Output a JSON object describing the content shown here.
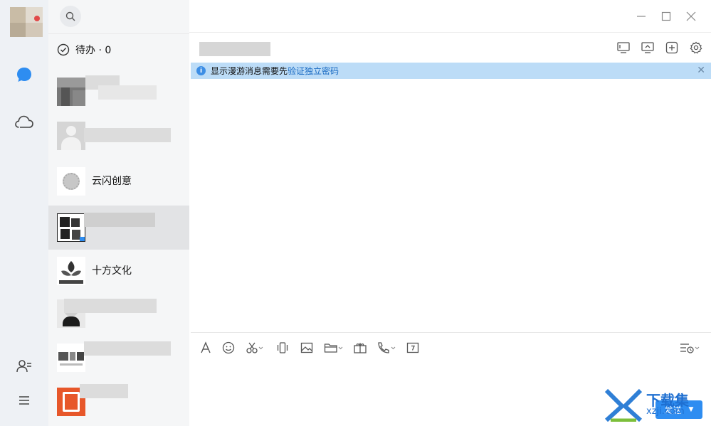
{
  "sidebar": {
    "icons": [
      "chat-bubble-icon",
      "cloud-icon",
      "contacts-icon",
      "menu-icon"
    ]
  },
  "todo": {
    "label": "待办 · 0"
  },
  "contacts": [
    {
      "name": "",
      "blurred": true
    },
    {
      "name": "",
      "blurred": true
    },
    {
      "name": "云闪创意",
      "blurred": false
    },
    {
      "name": "",
      "blurred": true,
      "selected": true
    },
    {
      "name": "十方文化",
      "blurred": false
    },
    {
      "name": "",
      "blurred": true
    },
    {
      "name": "",
      "blurred": true
    },
    {
      "name": "",
      "blurred": true
    }
  ],
  "banner": {
    "text": "显示漫游消息需要先",
    "link": "验证独立密码"
  },
  "compose": {
    "send_label": "发送"
  },
  "watermark": {
    "brand": "下载集",
    "url": "xzji.com"
  },
  "colors": {
    "accent": "#2e8df1",
    "banner_bg": "#bcdcf7",
    "rail_bg": "#eef1f5"
  }
}
